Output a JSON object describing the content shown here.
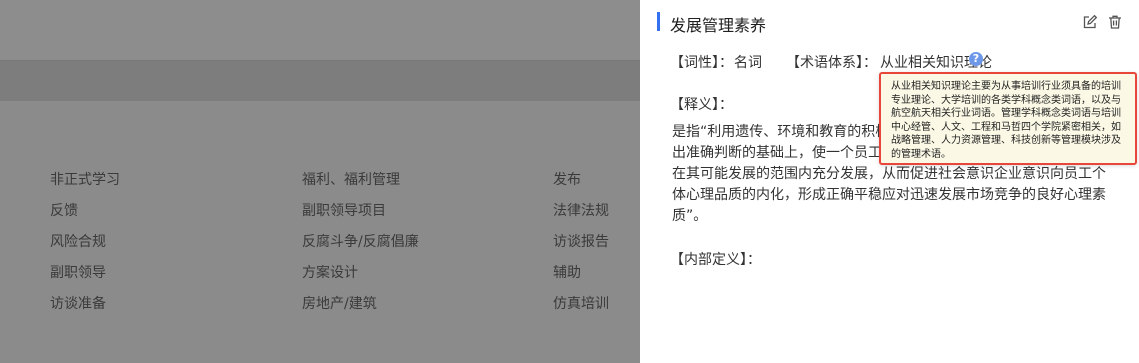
{
  "background": {
    "columns": [
      [
        "非正式学习",
        "反馈",
        "风险合规",
        "副职领导",
        "访谈准备"
      ],
      [
        "福利、福利管理",
        "副职领导项目",
        "反腐斗争/反腐倡廉",
        "方案设计",
        "房地产/建筑"
      ],
      [
        "发布",
        "法律法规",
        "访谈报告",
        "辅助",
        "仿真培训"
      ]
    ]
  },
  "drawer": {
    "title": "发展管理素养",
    "pos_label": "【词性】：",
    "pos_value": "名词",
    "system_label": "【术语体系】：",
    "system_value": "从业相关知识理论",
    "definition_label": "【释义】：",
    "definition_text": "是指“利用遗传、环境和教育的积极作用，使人的身心潜能发展潜力做出准确判断的基础上，使一个员工都在其已有发展水平上有所发展，都在其可能发展的范围内充分发展，从而促进社会意识企业意识向员工个体心理品质的内化，形成正确平稳应对迅速发展市场竞争的良好心理素质”。",
    "internal_label": "【内部定义】："
  },
  "tooltip": {
    "text": "从业相关知识理论主要为从事培训行业须具备的培训专业理论、大学培训的各类学科概念类词语，以及与航空航天相关行业词语。管理学科概念类词语与培训中心经管、人文、工程和马哲四个学院紧密相关，如战略管理、人力资源管理、科技创新等管理模块涉及的管理术语。"
  },
  "colors": {
    "accent": "#3471f0",
    "tooltip_border": "#e8463a",
    "overlay": "#8b8b8b"
  }
}
